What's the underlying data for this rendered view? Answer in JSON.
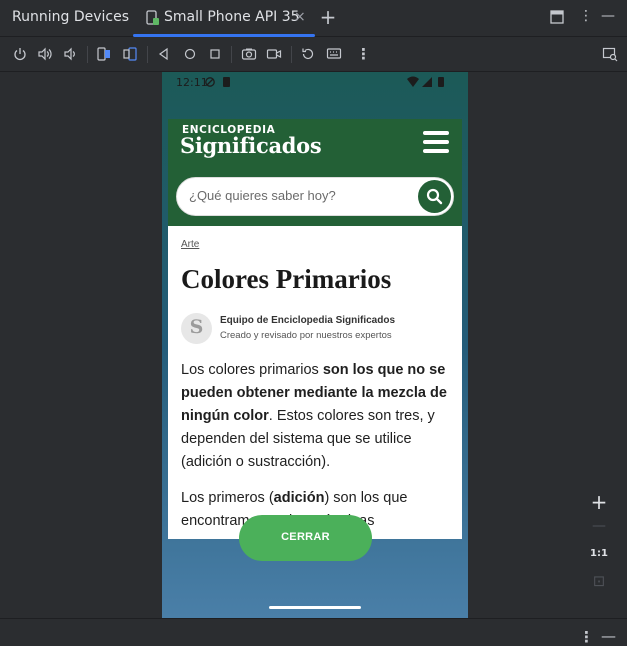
{
  "ide": {
    "panel_title": "Running Devices",
    "tab_label": "Small Phone API 35",
    "tab_close": "×",
    "tab_add": "+",
    "more_label": "⋮",
    "minimize_label": "—",
    "toolbar_icons": [
      "power-icon",
      "volume-up-icon",
      "volume-down-icon",
      "rotate-left-icon",
      "rotate-right-icon",
      "back-icon",
      "home-icon",
      "overview-icon",
      "camera-icon",
      "video-icon",
      "reset-icon",
      "keyboard-icon",
      "more-icon",
      "device-mirroring-icon"
    ],
    "zoom": {
      "in": "+",
      "out": "—",
      "actual": "1:1",
      "fit": "⊡"
    }
  },
  "device": {
    "status_time": "12:11",
    "site": {
      "logo_top": "ENCICLOPEDIA",
      "logo_main": "Significados",
      "search_placeholder": "¿Qué quieres saber hoy?"
    },
    "article": {
      "breadcrumb": "Arte",
      "title": "Colores Primarios",
      "avatar_letter": "S",
      "author": "Equipo de Enciclopedia Significados",
      "author_sub": "Creado y revisado por nuestros expertos",
      "p1_a": "Los colores primarios ",
      "p1_b": "son los que no se pueden obtener mediante la mezcla de ningún color",
      "p1_c": ". Estos colores son tres, y dependen del sistema que se utilice (adición o sustracción).",
      "p2_a": "Los primeros (",
      "p2_b": "adición",
      "p2_c": ") son los que encontramos en las máquinas"
    },
    "close_button": "CERRAR"
  }
}
